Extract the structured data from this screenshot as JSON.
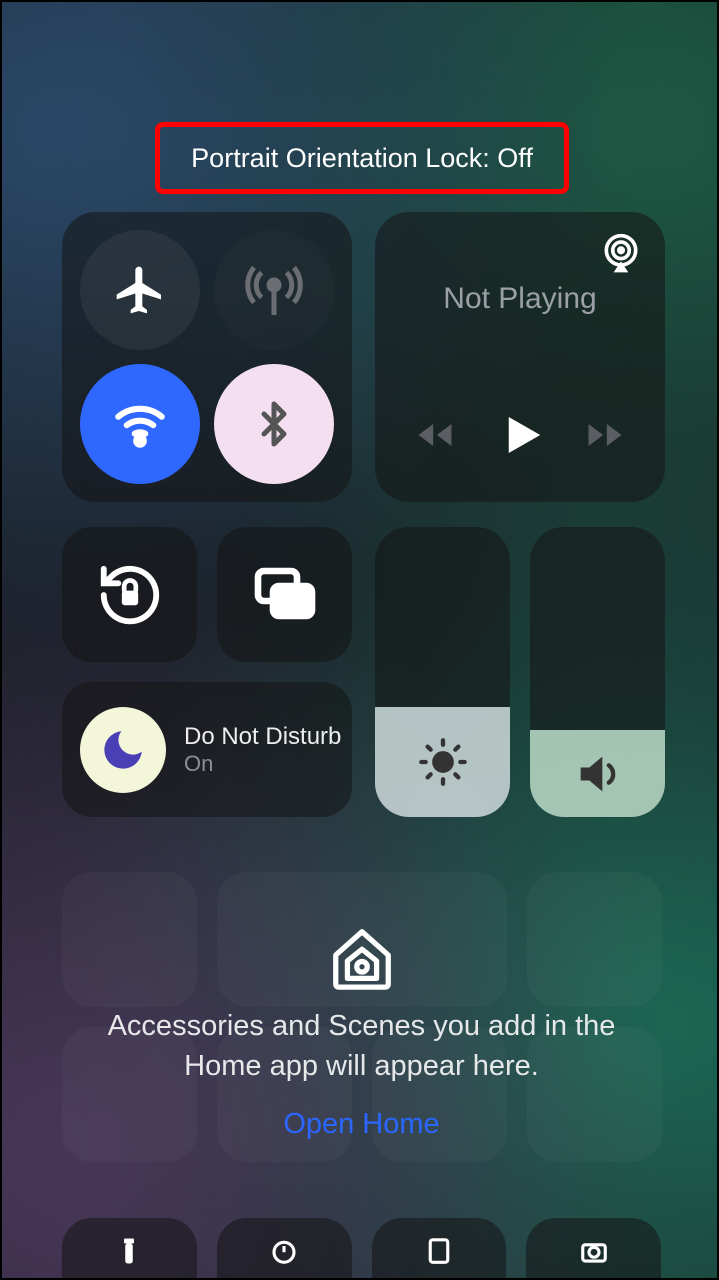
{
  "status_banner": "Portrait Orientation Lock: Off",
  "connectivity": {
    "airplane": "airplane-icon",
    "cellular": "cellular-antenna-icon",
    "wifi": "wifi-icon",
    "bluetooth": "bluetooth-icon"
  },
  "media": {
    "title": "Not Playing",
    "airplay": "airplay-icon"
  },
  "orientation_lock": "orientation-lock-icon",
  "screen_mirroring": "screen-mirroring-icon",
  "dnd": {
    "title": "Do Not Disturb",
    "status": "On"
  },
  "brightness_percent": 38,
  "volume_percent": 30,
  "home": {
    "message": "Accessories and Scenes you add in the Home app will appear here.",
    "link": "Open Home"
  }
}
